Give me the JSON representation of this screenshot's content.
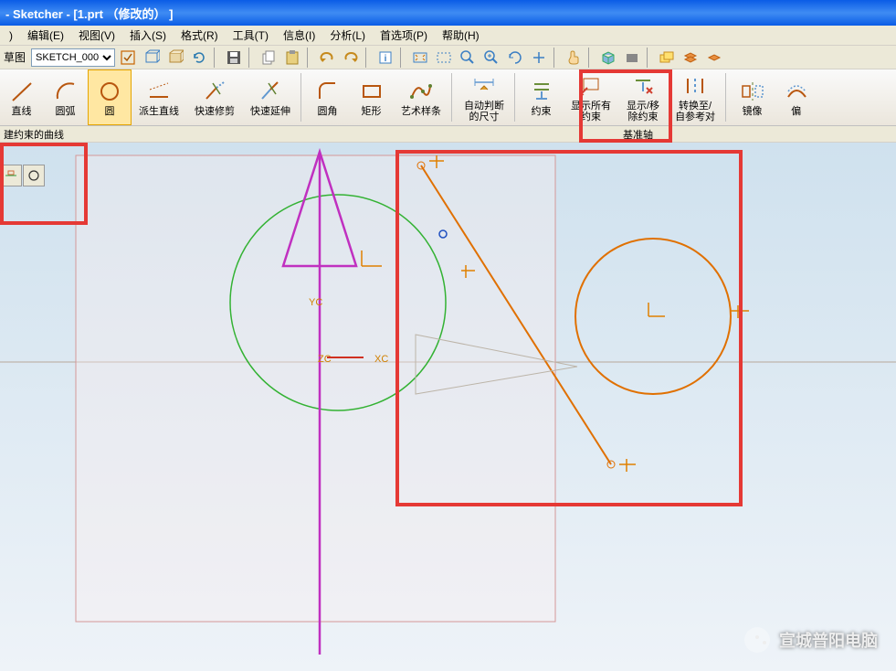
{
  "title": "- Sketcher - [1.prt （修改的） ]",
  "menu": {
    "edit": "编辑(E)",
    "view": "视图(V)",
    "insert": "插入(S)",
    "format": "格式(R)",
    "tools": "工具(T)",
    "info": "信息(I)",
    "analysis": "分析(L)",
    "prefs": "首选项(P)",
    "help": "帮助(H)"
  },
  "toolbar1": {
    "sketch_label": "草图",
    "sketch_value": "SKETCH_000"
  },
  "ribbon": {
    "line": "直线",
    "arc": "圆弧",
    "circle": "圆",
    "derived": "派生直线",
    "qtrim": "快速修剪",
    "qextend": "快速延伸",
    "fillet": "圆角",
    "rect": "矩形",
    "spline": "艺术样条",
    "autodim": "自动判断\n的尺寸",
    "constrain": "约束",
    "showall": "显示所有\n约束",
    "showrem": "显示/移\n除约束",
    "self": "转换至/\n自参考对",
    "mirror": "镜像",
    "offset": "偏"
  },
  "status": {
    "left": "建约束的曲线",
    "right": "基准轴"
  },
  "canvas_labels": {
    "yc": "YC",
    "zc": "ZC",
    "xc": "XC"
  },
  "watermark": "宣城普阳电脑"
}
